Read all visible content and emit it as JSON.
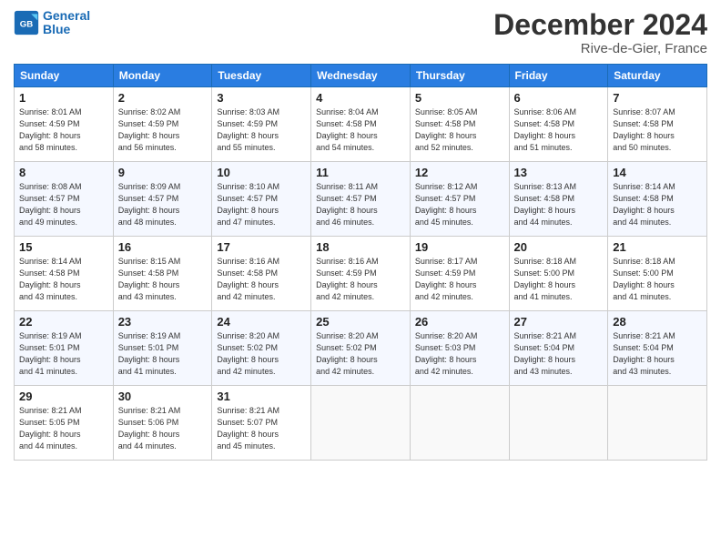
{
  "logo": {
    "line1": "General",
    "line2": "Blue"
  },
  "title": "December 2024",
  "subtitle": "Rive-de-Gier, France",
  "days_header": [
    "Sunday",
    "Monday",
    "Tuesday",
    "Wednesday",
    "Thursday",
    "Friday",
    "Saturday"
  ],
  "weeks": [
    [
      {
        "day": "1",
        "info": "Sunrise: 8:01 AM\nSunset: 4:59 PM\nDaylight: 8 hours\nand 58 minutes."
      },
      {
        "day": "2",
        "info": "Sunrise: 8:02 AM\nSunset: 4:59 PM\nDaylight: 8 hours\nand 56 minutes."
      },
      {
        "day": "3",
        "info": "Sunrise: 8:03 AM\nSunset: 4:59 PM\nDaylight: 8 hours\nand 55 minutes."
      },
      {
        "day": "4",
        "info": "Sunrise: 8:04 AM\nSunset: 4:58 PM\nDaylight: 8 hours\nand 54 minutes."
      },
      {
        "day": "5",
        "info": "Sunrise: 8:05 AM\nSunset: 4:58 PM\nDaylight: 8 hours\nand 52 minutes."
      },
      {
        "day": "6",
        "info": "Sunrise: 8:06 AM\nSunset: 4:58 PM\nDaylight: 8 hours\nand 51 minutes."
      },
      {
        "day": "7",
        "info": "Sunrise: 8:07 AM\nSunset: 4:58 PM\nDaylight: 8 hours\nand 50 minutes."
      }
    ],
    [
      {
        "day": "8",
        "info": "Sunrise: 8:08 AM\nSunset: 4:57 PM\nDaylight: 8 hours\nand 49 minutes."
      },
      {
        "day": "9",
        "info": "Sunrise: 8:09 AM\nSunset: 4:57 PM\nDaylight: 8 hours\nand 48 minutes."
      },
      {
        "day": "10",
        "info": "Sunrise: 8:10 AM\nSunset: 4:57 PM\nDaylight: 8 hours\nand 47 minutes."
      },
      {
        "day": "11",
        "info": "Sunrise: 8:11 AM\nSunset: 4:57 PM\nDaylight: 8 hours\nand 46 minutes."
      },
      {
        "day": "12",
        "info": "Sunrise: 8:12 AM\nSunset: 4:57 PM\nDaylight: 8 hours\nand 45 minutes."
      },
      {
        "day": "13",
        "info": "Sunrise: 8:13 AM\nSunset: 4:58 PM\nDaylight: 8 hours\nand 44 minutes."
      },
      {
        "day": "14",
        "info": "Sunrise: 8:14 AM\nSunset: 4:58 PM\nDaylight: 8 hours\nand 44 minutes."
      }
    ],
    [
      {
        "day": "15",
        "info": "Sunrise: 8:14 AM\nSunset: 4:58 PM\nDaylight: 8 hours\nand 43 minutes."
      },
      {
        "day": "16",
        "info": "Sunrise: 8:15 AM\nSunset: 4:58 PM\nDaylight: 8 hours\nand 43 minutes."
      },
      {
        "day": "17",
        "info": "Sunrise: 8:16 AM\nSunset: 4:58 PM\nDaylight: 8 hours\nand 42 minutes."
      },
      {
        "day": "18",
        "info": "Sunrise: 8:16 AM\nSunset: 4:59 PM\nDaylight: 8 hours\nand 42 minutes."
      },
      {
        "day": "19",
        "info": "Sunrise: 8:17 AM\nSunset: 4:59 PM\nDaylight: 8 hours\nand 42 minutes."
      },
      {
        "day": "20",
        "info": "Sunrise: 8:18 AM\nSunset: 5:00 PM\nDaylight: 8 hours\nand 41 minutes."
      },
      {
        "day": "21",
        "info": "Sunrise: 8:18 AM\nSunset: 5:00 PM\nDaylight: 8 hours\nand 41 minutes."
      }
    ],
    [
      {
        "day": "22",
        "info": "Sunrise: 8:19 AM\nSunset: 5:01 PM\nDaylight: 8 hours\nand 41 minutes."
      },
      {
        "day": "23",
        "info": "Sunrise: 8:19 AM\nSunset: 5:01 PM\nDaylight: 8 hours\nand 41 minutes."
      },
      {
        "day": "24",
        "info": "Sunrise: 8:20 AM\nSunset: 5:02 PM\nDaylight: 8 hours\nand 42 minutes."
      },
      {
        "day": "25",
        "info": "Sunrise: 8:20 AM\nSunset: 5:02 PM\nDaylight: 8 hours\nand 42 minutes."
      },
      {
        "day": "26",
        "info": "Sunrise: 8:20 AM\nSunset: 5:03 PM\nDaylight: 8 hours\nand 42 minutes."
      },
      {
        "day": "27",
        "info": "Sunrise: 8:21 AM\nSunset: 5:04 PM\nDaylight: 8 hours\nand 43 minutes."
      },
      {
        "day": "28",
        "info": "Sunrise: 8:21 AM\nSunset: 5:04 PM\nDaylight: 8 hours\nand 43 minutes."
      }
    ],
    [
      {
        "day": "29",
        "info": "Sunrise: 8:21 AM\nSunset: 5:05 PM\nDaylight: 8 hours\nand 44 minutes."
      },
      {
        "day": "30",
        "info": "Sunrise: 8:21 AM\nSunset: 5:06 PM\nDaylight: 8 hours\nand 44 minutes."
      },
      {
        "day": "31",
        "info": "Sunrise: 8:21 AM\nSunset: 5:07 PM\nDaylight: 8 hours\nand 45 minutes."
      },
      {
        "day": "",
        "info": ""
      },
      {
        "day": "",
        "info": ""
      },
      {
        "day": "",
        "info": ""
      },
      {
        "day": "",
        "info": ""
      }
    ]
  ]
}
